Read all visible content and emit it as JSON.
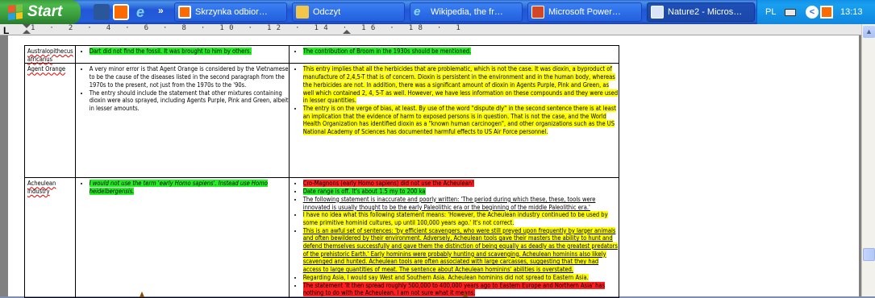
{
  "taskbar": {
    "start_label": "Start",
    "more_label": "»",
    "buttons": [
      {
        "label": "Skrzynka odbior…",
        "icon": "outlook-icon",
        "color": "#ff6a00"
      },
      {
        "label": "Odczyt",
        "icon": "folder-icon",
        "color": "#f3c64a"
      },
      {
        "label": "Wikipedia, the fr…",
        "icon": "internet-explorer-icon",
        "color": "#3aa0ff"
      },
      {
        "label": "Microsoft Power…",
        "icon": "powerpoint-icon",
        "color": "#d24726"
      },
      {
        "label": "Nature2 - Micros…",
        "icon": "word-icon",
        "color": "#2b579a"
      }
    ],
    "tray": {
      "language": "PL",
      "clock": "13:13"
    }
  },
  "ruler": {
    "text": "1 · 2 · 4 · 6 · 8 · 10 · 12 · 14 · 16 · 18 · 1"
  },
  "table": {
    "rows": [
      {
        "term": "Australopithecus africanus",
        "col2": [
          {
            "hl": "g",
            "text": "Dart did not find the fossil. It was brought to him by others."
          }
        ],
        "col3": [
          {
            "hl": "g",
            "text": "The contribution of Broom in the 1930s should be mentioned."
          }
        ]
      },
      {
        "term": "Agent Orange",
        "col2": [
          {
            "hl": "",
            "text": "A very minor error is that Agent Orange is considered by the Vietnamese to be the cause of the diseases listed in the second paragraph from the 1970s to the present, not just from the 1970s to the '90s."
          },
          {
            "hl": "",
            "text": "The entry should include the statement that other mixtures containing dioxin were also sprayed, including Agents Purple, Pink and Green, albeit in lesser amounts."
          }
        ],
        "col3": [
          {
            "hl": "y",
            "text": "This entry implies that all the herbicides that are problematic, which is not the case. It was dioxin, a byproduct of manufacture of 2,4,5-T that is of concern. Dioxin is persistent in the environment and in the human body, whereas the herbicides are not. In addition, there was a significant amount of dioxin in Agents Purple, Pink and Green, as well which contained 2, 4, 5-T as well. However, we have less information on these compounds and they were used in lesser quantities."
          },
          {
            "hl": "y",
            "text": "The entry is on the verge of bias, at least. By use of the word \"dispute dly\" in the second sentence there is at least an implication that the evidence of harm to exposed persons is in question. That is not the case, and the World Health Organization has identified dioxin as a \"known human carcinogen\", and other organizations such as the US National Academy of Sciences has documented harmful effects to US Air Force personnel."
          }
        ]
      },
      {
        "term": "Acheulean industry",
        "col2": [
          {
            "hl": "g",
            "text": "I would not use the term 'early Homo sapiens'. Instead use Homo heidelbergensis."
          }
        ],
        "col3": [
          {
            "hl": "r",
            "text": "Cro-Magnons (early Homo sapiens) did not use the Acheulean!"
          },
          {
            "hl": "g",
            "text": "Date range is off. It's about 1.5 my to 200 ka"
          },
          {
            "hl": "",
            "text": "The following statement is inaccurate and poorly written: 'The period during which these, these, tools were innovated is usually thought to be the early Paleolithic era or the beginning of the middle Paleolithic era.'"
          },
          {
            "hl": "y",
            "text": "I have no idea what this following statement means: 'However, the Acheulean industry continued to be used by some primitive hominid cultures, up until 100,000 years ago.' It's not correct."
          },
          {
            "hl": "y",
            "text": "This is an awful set of sentences: 'by efficient scavengers, who were still preyed upon frequently by larger animals and often bewildered by their environment. Adversely, Acheulean tools gave their masters the ability to hunt and defend themselves successfully and gave them the distinction of being equally as deadly as the greatest predators of the prehistoric Earth.' Early hominins were probably hunting and scavenging. Acheulean hominins also likely scavenged and hunted. Acheulean tools are often associated with large carcasses, suggesting that they had access to large quantities of meat. The sentence about Acheulean hominins' abilities is overstated."
          },
          {
            "hl": "y",
            "text": "Regarding Asia, I would say West and Southern Asia. Acheulean hominins did not spread to Eastern Asia."
          },
          {
            "hl": "r",
            "text": "The statement 'It then spread roughly 500,000 to 400,000 years ago to Eastern Europe and Northern Asia' has nothing to do with the Acheulean. I am not sure what it means."
          }
        ]
      }
    ]
  },
  "colors": {
    "taskbar": "#245edb",
    "start": "#3c9a3c",
    "highlight_green": "#22ee22",
    "highlight_yellow": "#ffff00",
    "highlight_red": "#ff1f1f"
  }
}
